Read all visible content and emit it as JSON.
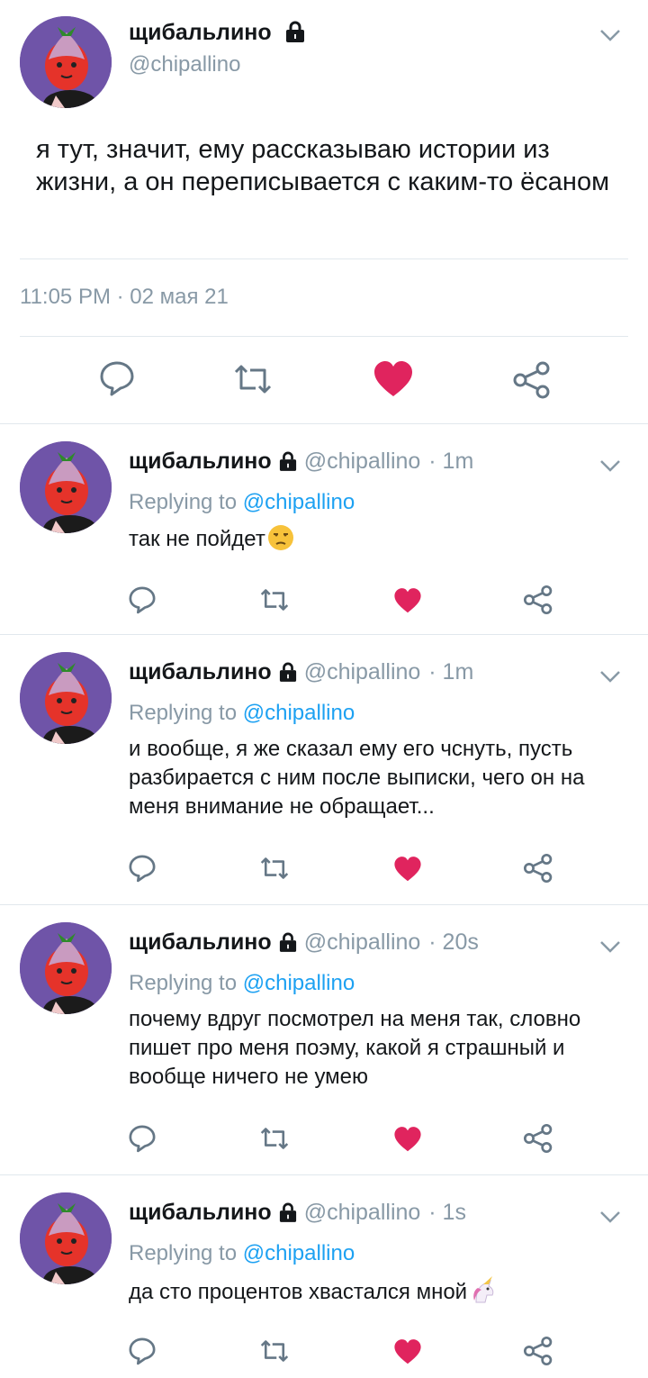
{
  "main_tweet": {
    "display_name": "щибальлино",
    "handle": "@chipallino",
    "text": "я тут, значит, ему рассказываю истории из жизни, а он переписывается с каким-то ёсаном",
    "timestamp": "11:05 PM · 02 мая 21"
  },
  "replies": [
    {
      "display_name": "щибальлино",
      "handle": "@chipallino",
      "time": "· 1m",
      "replying_prefix": "Replying to ",
      "replying_handle": "@chipallino",
      "text": "так не пойдет",
      "emoji": "unamused-face-emoji"
    },
    {
      "display_name": "щибальлино",
      "handle": "@chipallino",
      "time": "· 1m",
      "replying_prefix": "Replying to ",
      "replying_handle": "@chipallino",
      "text": "и вообще, я же сказал ему его чснуть, пусть разбирается с ним после выписки, чего он на меня внимание не обращает...",
      "emoji": ""
    },
    {
      "display_name": "щибальлино",
      "handle": "@chipallino",
      "time": "· 20s",
      "replying_prefix": "Replying to ",
      "replying_handle": "@chipallino",
      "text": "почему вдруг посмотрел на меня так, словно пишет про меня поэму, какой я страшный и вообще ничего не умею",
      "emoji": ""
    },
    {
      "display_name": "щибальлино",
      "handle": "@chipallino",
      "time": "· 1s",
      "replying_prefix": "Replying to ",
      "replying_handle": "@chipallino",
      "text": "да сто процентов хвастался мной",
      "emoji": "unicorn-emoji"
    }
  ],
  "colors": {
    "like": "#e0245e",
    "icon": "#657786",
    "mention": "#1da1f2",
    "muted": "#8899a6",
    "avatar_bg": "#6f54a8"
  }
}
